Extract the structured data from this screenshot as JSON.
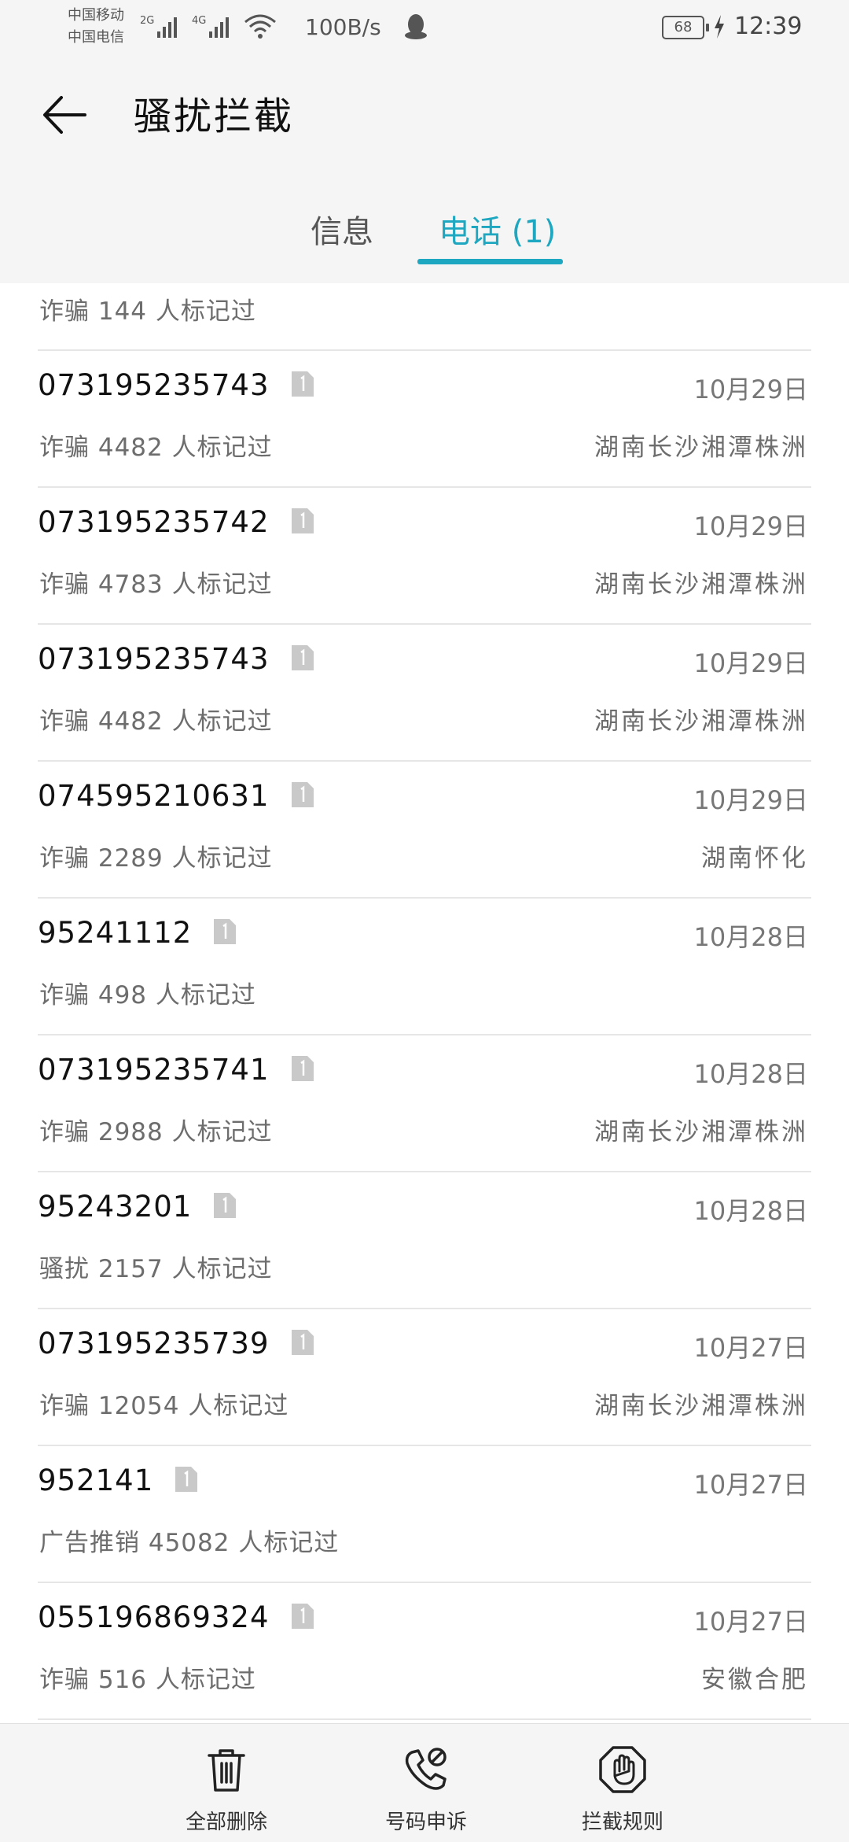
{
  "status_bar": {
    "carrier_1": "中国移动",
    "carrier_2": "中国电信",
    "net_1": "2G",
    "net_2": "4G",
    "net_speed": "100B/s",
    "battery": "68",
    "time": "12:39"
  },
  "header": {
    "title": "骚扰拦截"
  },
  "tabs": [
    {
      "label": "信息"
    },
    {
      "label": "电话 (1)"
    }
  ],
  "partial_row": {
    "desc": "诈骗  144 人标记过"
  },
  "calls": [
    {
      "number": "073195235743",
      "date": "10月29日",
      "desc": "诈骗  4482 人标记过",
      "location": "湖南长沙湘潭株洲"
    },
    {
      "number": "073195235742",
      "date": "10月29日",
      "desc": "诈骗  4783 人标记过",
      "location": "湖南长沙湘潭株洲"
    },
    {
      "number": "073195235743",
      "date": "10月29日",
      "desc": "诈骗  4482 人标记过",
      "location": "湖南长沙湘潭株洲"
    },
    {
      "number": "074595210631",
      "date": "10月29日",
      "desc": "诈骗  2289 人标记过",
      "location": "湖南怀化"
    },
    {
      "number": "95241112",
      "date": "10月28日",
      "desc": "诈骗  498 人标记过",
      "location": ""
    },
    {
      "number": "073195235741",
      "date": "10月28日",
      "desc": "诈骗  2988 人标记过",
      "location": "湖南长沙湘潭株洲"
    },
    {
      "number": "95243201",
      "date": "10月28日",
      "desc": "骚扰  2157 人标记过",
      "location": ""
    },
    {
      "number": "073195235739",
      "date": "10月27日",
      "desc": "诈骗  12054 人标记过",
      "location": "湖南长沙湘潭株洲"
    },
    {
      "number": "952141",
      "date": "10月27日",
      "desc": "广告推销  45082 人标记过",
      "location": ""
    },
    {
      "number": "055196869324",
      "date": "10月27日",
      "desc": "诈骗  516 人标记过",
      "location": "安徽合肥"
    }
  ],
  "bottom_bar": {
    "delete_all": "全部删除",
    "appeal": "号码申诉",
    "rules": "拦截规则"
  },
  "colors": {
    "accent": "#1ea7c0",
    "header_bg": "#f5f5f5"
  },
  "icons": [
    "back-arrow-icon",
    "sim-1-icon",
    "trash-icon",
    "phone-blocked-icon",
    "hand-stop-icon",
    "qq-icon",
    "wifi-icon",
    "signal-icon",
    "battery-icon",
    "charging-icon"
  ]
}
